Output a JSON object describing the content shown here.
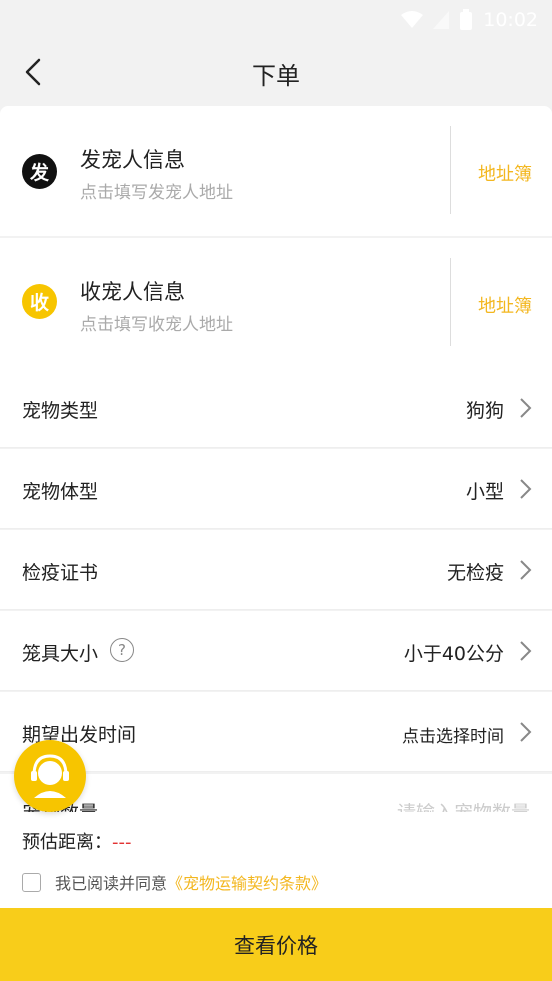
{
  "status": {
    "time": "10:02"
  },
  "nav": {
    "title": "下单"
  },
  "sender": {
    "badge": "发",
    "title": "发宠人信息",
    "subtitle": "点击填写发宠人地址",
    "address_book": "地址簿"
  },
  "receiver": {
    "badge": "收",
    "title": "收宠人信息",
    "subtitle": "点击填写收宠人地址",
    "address_book": "地址簿"
  },
  "rows": [
    {
      "label": "宠物类型",
      "value": "狗狗"
    },
    {
      "label": "宠物体型",
      "value": "小型"
    },
    {
      "label": "检疫证书",
      "value": "无检疫"
    },
    {
      "label": "笼具大小",
      "value": "小于40公分"
    },
    {
      "label": "期望出发时间",
      "value": "点击选择时间"
    }
  ],
  "partial": {
    "label": "宠物数量",
    "placeholder": "请输入宠物数量"
  },
  "bottom": {
    "distance_label": "预估距离：",
    "distance_value": "---",
    "agree_text": "我已阅读并同意",
    "agree_link": "《宠物运输契约条款》"
  },
  "cta": {
    "label": "查看价格"
  },
  "colors": {
    "accent": "#f8cd1a",
    "link": "#f3b720",
    "alert": "#e23333"
  }
}
